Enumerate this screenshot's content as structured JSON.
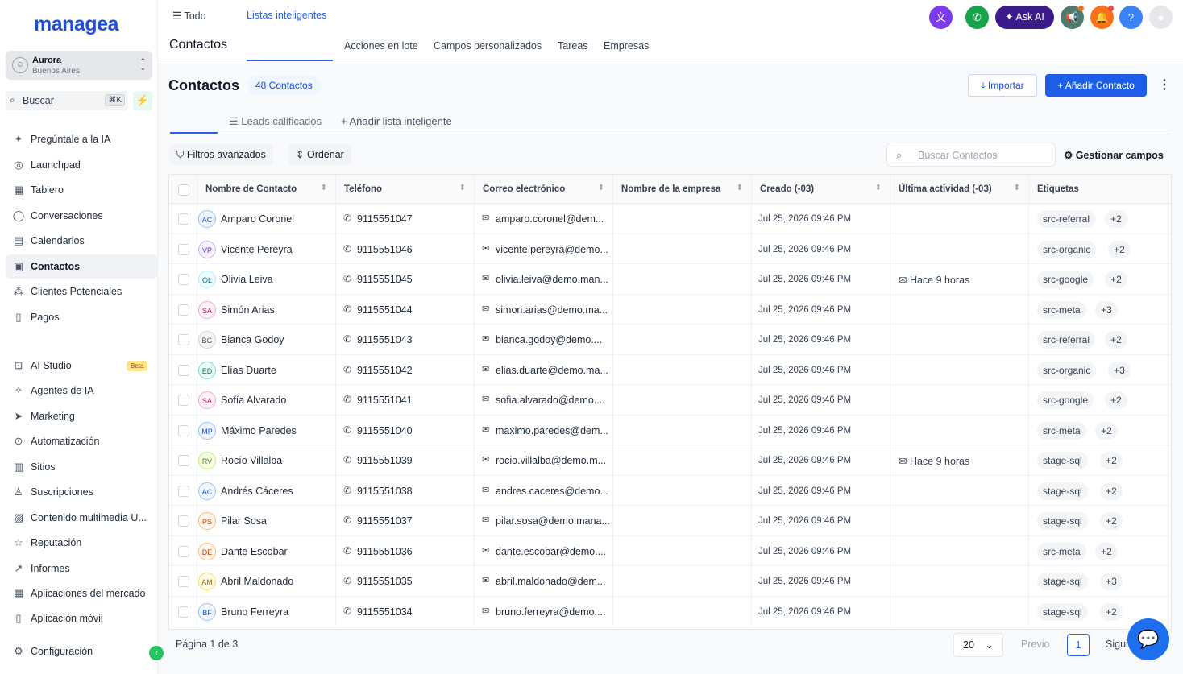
{
  "app": {
    "logo": "managea"
  },
  "location": {
    "name": "Aurora",
    "city": "Buenos Aires",
    "initial": "☺"
  },
  "search": {
    "label": "Buscar",
    "shortcut": "⌘K"
  },
  "nav": [
    {
      "label": "Pregúntale a la IA",
      "icon": "✦"
    },
    {
      "label": "Launchpad",
      "icon": "◎"
    },
    {
      "label": "Tablero",
      "icon": "▦"
    },
    {
      "label": "Conversaciones",
      "icon": "◯"
    },
    {
      "label": "Calendarios",
      "icon": "▤"
    },
    {
      "label": "Contactos",
      "icon": "▣"
    },
    {
      "label": "Clientes Potenciales",
      "icon": "⁂"
    },
    {
      "label": "Pagos",
      "icon": "▯"
    }
  ],
  "nav2": [
    {
      "label": "AI Studio",
      "icon": "⊡"
    },
    {
      "label": "Agentes de IA",
      "icon": "✧"
    },
    {
      "label": "Marketing",
      "icon": "➤"
    },
    {
      "label": "Automatización",
      "icon": "⊙"
    },
    {
      "label": "Sitios",
      "icon": "▥"
    },
    {
      "label": "Suscripciones",
      "icon": "♙"
    },
    {
      "label": "Contenido multimedia U...",
      "icon": "▨"
    },
    {
      "label": "Reputación",
      "icon": "☆"
    },
    {
      "label": "Informes",
      "icon": "↗"
    },
    {
      "label": "Aplicaciones del mercado",
      "icon": "▦"
    },
    {
      "label": "Aplicación móvil",
      "icon": "▯"
    }
  ],
  "beta": "Beta",
  "settings": {
    "label": "Configuración",
    "icon": "⚙"
  },
  "topbar": {
    "title": "Contactos",
    "tabs": [
      "Listas inteligentes",
      "Acciones en lote",
      "Campos personalizados",
      "Tareas",
      "Empresas"
    ],
    "ask_ai": "✦ Ask AI"
  },
  "header": {
    "title": "Contactos",
    "count": "48 Contactos",
    "import": "⤓  Importar",
    "add": "+  Añadir Contacto"
  },
  "lists": {
    "all": "Todo",
    "leads": "Leads calificados",
    "add": "+  Añadir lista inteligente"
  },
  "filters": {
    "advanced": "Filtros avanzados",
    "sort": "Ordenar",
    "search_placeholder": "Buscar Contactos",
    "manage": "Gestionar campos"
  },
  "columns": [
    "Nombre de Contacto",
    "Teléfono",
    "Correo electrónico",
    "Nombre de la empresa",
    "Creado (-03)",
    "Última actividad (-03)",
    "Etiquetas"
  ],
  "rows": [
    {
      "initials": "AC",
      "name": "Amparo Coronel",
      "phone": "9115551047",
      "email": "amparo.coronel@dem...",
      "created": "Jul 25, 2026 09:46 PM",
      "activity": "",
      "tag": "src-referral",
      "more": "+2"
    },
    {
      "initials": "VP",
      "name": "Vicente Pereyra",
      "phone": "9115551046",
      "email": "vicente.pereyra@demo...",
      "created": "Jul 25, 2026 09:46 PM",
      "activity": "",
      "tag": "src-organic",
      "more": "+2"
    },
    {
      "initials": "OL",
      "name": "Olivia Leiva",
      "phone": "9115551045",
      "email": "olivia.leiva@demo.man...",
      "created": "Jul 25, 2026 09:46 PM",
      "activity": "Hace 9 horas",
      "tag": "src-google",
      "more": "+2"
    },
    {
      "initials": "SA",
      "name": "Simón Arias",
      "phone": "9115551044",
      "email": "simon.arias@demo.ma...",
      "created": "Jul 25, 2026 09:46 PM",
      "activity": "",
      "tag": "src-meta",
      "more": "+3"
    },
    {
      "initials": "BG",
      "name": "Bianca Godoy",
      "phone": "9115551043",
      "email": "bianca.godoy@demo....",
      "created": "Jul 25, 2026 09:46 PM",
      "activity": "",
      "tag": "src-referral",
      "more": "+2"
    },
    {
      "initials": "ED",
      "name": "Elías Duarte",
      "phone": "9115551042",
      "email": "elias.duarte@demo.ma...",
      "created": "Jul 25, 2026 09:46 PM",
      "activity": "",
      "tag": "src-organic",
      "more": "+3"
    },
    {
      "initials": "SA",
      "name": "Sofía Alvarado",
      "phone": "9115551041",
      "email": "sofia.alvarado@demo....",
      "created": "Jul 25, 2026 09:46 PM",
      "activity": "",
      "tag": "src-google",
      "more": "+2"
    },
    {
      "initials": "MP",
      "name": "Máximo Paredes",
      "phone": "9115551040",
      "email": "maximo.paredes@dem...",
      "created": "Jul 25, 2026 09:46 PM",
      "activity": "",
      "tag": "src-meta",
      "more": "+2"
    },
    {
      "initials": "RV",
      "name": "Rocío Villalba",
      "phone": "9115551039",
      "email": "rocio.villalba@demo.m...",
      "created": "Jul 25, 2026 09:46 PM",
      "activity": "Hace 9 horas",
      "tag": "stage-sql",
      "more": "+2"
    },
    {
      "initials": "AC",
      "name": "Andrés Cáceres",
      "phone": "9115551038",
      "email": "andres.caceres@demo...",
      "created": "Jul 25, 2026 09:46 PM",
      "activity": "",
      "tag": "stage-sql",
      "more": "+2"
    },
    {
      "initials": "PS",
      "name": "Pilar Sosa",
      "phone": "9115551037",
      "email": "pilar.sosa@demo.mana...",
      "created": "Jul 25, 2026 09:46 PM",
      "activity": "",
      "tag": "stage-sql",
      "more": "+2"
    },
    {
      "initials": "DE",
      "name": "Dante Escobar",
      "phone": "9115551036",
      "email": "dante.escobar@demo....",
      "created": "Jul 25, 2026 09:46 PM",
      "activity": "",
      "tag": "src-meta",
      "more": "+2"
    },
    {
      "initials": "AM",
      "name": "Abril Maldonado",
      "phone": "9115551035",
      "email": "abril.maldonado@dem...",
      "created": "Jul 25, 2026 09:46 PM",
      "activity": "",
      "tag": "stage-sql",
      "more": "+3"
    },
    {
      "initials": "BF",
      "name": "Bruno Ferreyra",
      "phone": "9115551034",
      "email": "bruno.ferreyra@demo....",
      "created": "Jul 25, 2026 09:46 PM",
      "activity": "",
      "tag": "stage-sql",
      "more": "+2"
    }
  ],
  "pagination": {
    "label": "Página 1 de 3",
    "page_size": "20",
    "prev": "Previo",
    "page": "1",
    "next": "Siguiente"
  },
  "colors": {
    "accent": "#2563eb",
    "primary_button": "#1d5ee8",
    "ask_ai": "#3b1b8a"
  }
}
